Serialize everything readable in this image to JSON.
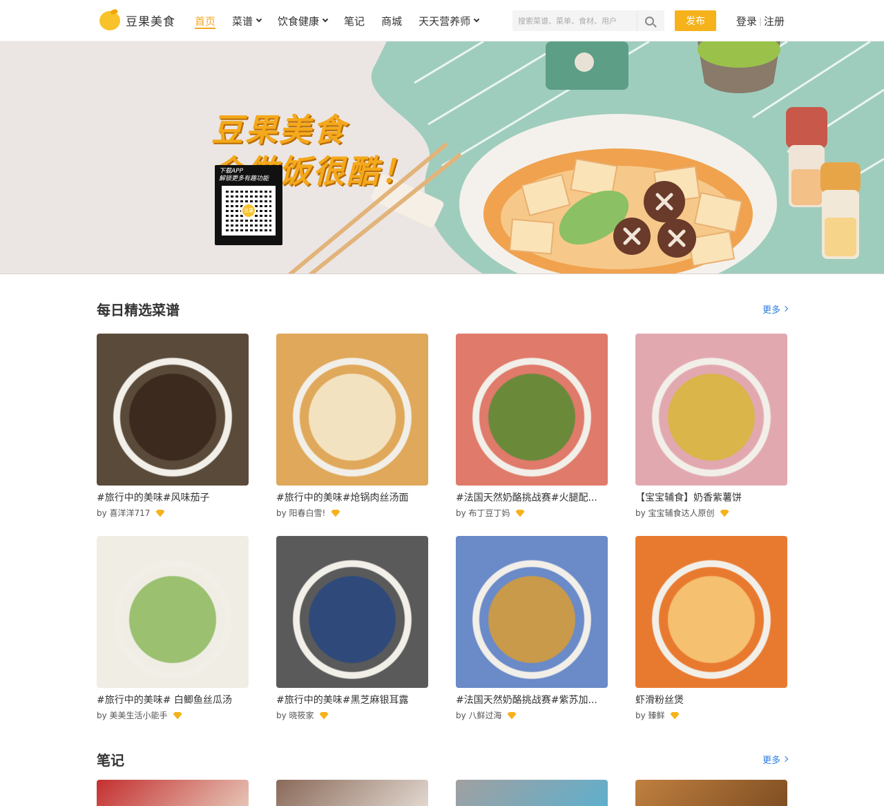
{
  "brand": {
    "name": "豆果美食",
    "accent": "#f5a623",
    "button_color": "#f5b21b",
    "link_color": "#2b7de0"
  },
  "nav": [
    {
      "label": "首页",
      "active": true,
      "dropdown": false
    },
    {
      "label": "菜谱",
      "active": false,
      "dropdown": true
    },
    {
      "label": "饮食健康",
      "active": false,
      "dropdown": true
    },
    {
      "label": "笔记",
      "active": false,
      "dropdown": false
    },
    {
      "label": "商城",
      "active": false,
      "dropdown": false
    },
    {
      "label": "天天营养师",
      "active": false,
      "dropdown": true
    }
  ],
  "search": {
    "placeholder": "搜索菜谱、菜单、食材、用户",
    "icon": "search-icon"
  },
  "publish_label": "发布",
  "auth": {
    "login": "登录",
    "separator": "|",
    "register": "注册"
  },
  "banner": {
    "line1": "豆果美食",
    "line2": "会做饭很酷！",
    "qr_line1": "下载APP",
    "qr_line2": "解锁更多有趣功能",
    "qr_center": "豆果"
  },
  "daily": {
    "title": "每日精选菜谱",
    "more": "更多",
    "recipes": [
      {
        "title": "#旅行中的美味#风味茄子",
        "author": "by 喜洋洋717",
        "colors": [
          "#5a4a3a",
          "#3d2a1e"
        ]
      },
      {
        "title": "#旅行中的美味#炝锅肉丝汤面",
        "author": "by 阳春白雪!",
        "colors": [
          "#e0a85a",
          "#f3e2c0"
        ]
      },
      {
        "title": "#法国天然奶酪挑战赛#火腿配...",
        "author": "by 布丁豆丁妈",
        "colors": [
          "#e07a6a",
          "#6a8a3a"
        ]
      },
      {
        "title": "【宝宝辅食】奶香紫薯饼",
        "author": "by 宝宝辅食达人原创",
        "colors": [
          "#e2a8b0",
          "#d9b54a"
        ]
      },
      {
        "title": "#旅行中的美味# 白鲫鱼丝瓜汤",
        "author": "by 美美生活小能手",
        "colors": [
          "#f0ede4",
          "#9ac070"
        ]
      },
      {
        "title": "#旅行中的美味#黑芝麻银耳露",
        "author": "by 晓筱家",
        "colors": [
          "#5a5a5a",
          "#2f4a7a"
        ]
      },
      {
        "title": "#法国天然奶酪挑战赛#紫苏加...",
        "author": "by 八鲜过海",
        "colors": [
          "#6a8ac8",
          "#c89a4a"
        ]
      },
      {
        "title": "虾滑粉丝煲",
        "author": "by 臻鲜",
        "colors": [
          "#e87a30",
          "#f5c070"
        ]
      }
    ]
  },
  "notes": {
    "title": "笔记",
    "more": "更多",
    "thumbs": [
      {
        "colors": [
          "#c43030",
          "#e8d0c0"
        ]
      },
      {
        "colors": [
          "#8a6a5a",
          "#e8e0d8"
        ]
      },
      {
        "colors": [
          "#a0a0a0",
          "#5ab0d0"
        ]
      },
      {
        "colors": [
          "#c08040",
          "#7a4a20"
        ]
      }
    ]
  }
}
